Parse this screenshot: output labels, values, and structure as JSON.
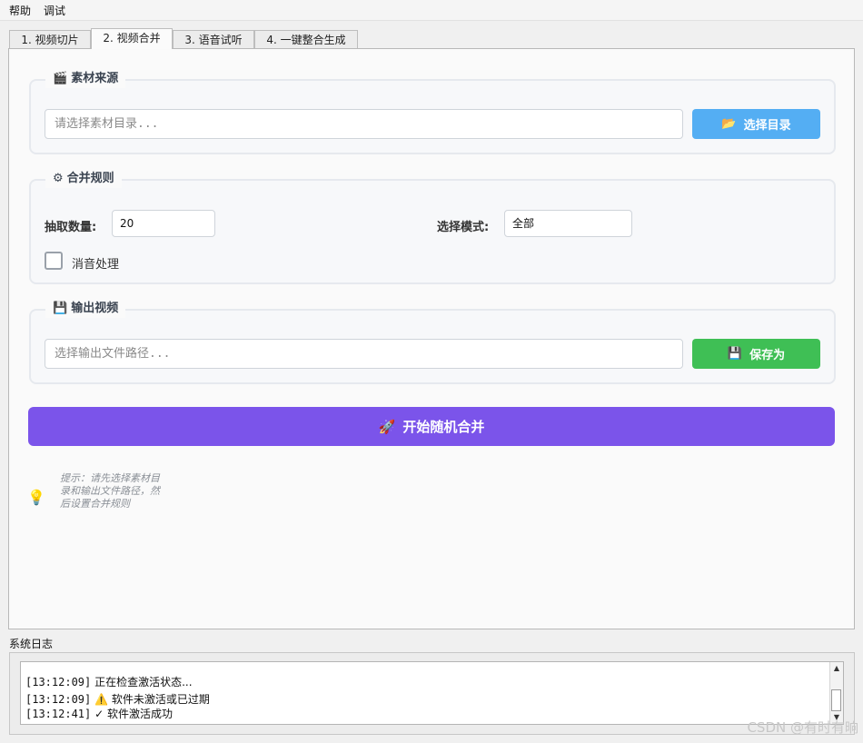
{
  "menu": [
    "帮助",
    "调试"
  ],
  "tabs": [
    "1. 视频切片",
    "2. 视频合并",
    "3. 语音试听",
    "4. 一键整合生成"
  ],
  "source_group": {
    "title": "素材来源",
    "icon": "clapperboard-icon",
    "input_placeholder": "请选择素材目录...",
    "button_label": "选择目录",
    "button_icon": "folder-icon"
  },
  "rules_group": {
    "title": "合并规则",
    "icon": "gear-icon",
    "count_label": "抽取数量:",
    "count_value": "20",
    "mode_label": "选择模式:",
    "mode_value": "全部",
    "mute_label": "消音处理"
  },
  "output_group": {
    "title": "输出视频",
    "icon": "floppy-disk-icon",
    "input_placeholder": "选择输出文件路径...",
    "button_label": "保存为",
    "button_icon": "floppy-disk-icon"
  },
  "start_button": {
    "label": "开始随机合并",
    "icon": "rocket-icon"
  },
  "hint": {
    "icon": "lightbulb-icon",
    "text": "提示：请先选择素材目录和输出文件路径，然后设置合并规则"
  },
  "log": {
    "title": "系统日志",
    "lines": [
      {
        "ts": "[13:12:09]",
        "icon": "",
        "text": "正在检查激活状态..."
      },
      {
        "ts": "[13:12:09]",
        "icon": "warning-icon",
        "text": "软件未激活或已过期"
      },
      {
        "ts": "[13:12:41]",
        "icon": "check-icon",
        "text": "软件激活成功"
      }
    ]
  },
  "watermark": "CSDN @有时有晌",
  "colors": {
    "blue_button": "#54aef3",
    "green_button": "#3fbf55",
    "purple_button": "#7b54ea"
  }
}
